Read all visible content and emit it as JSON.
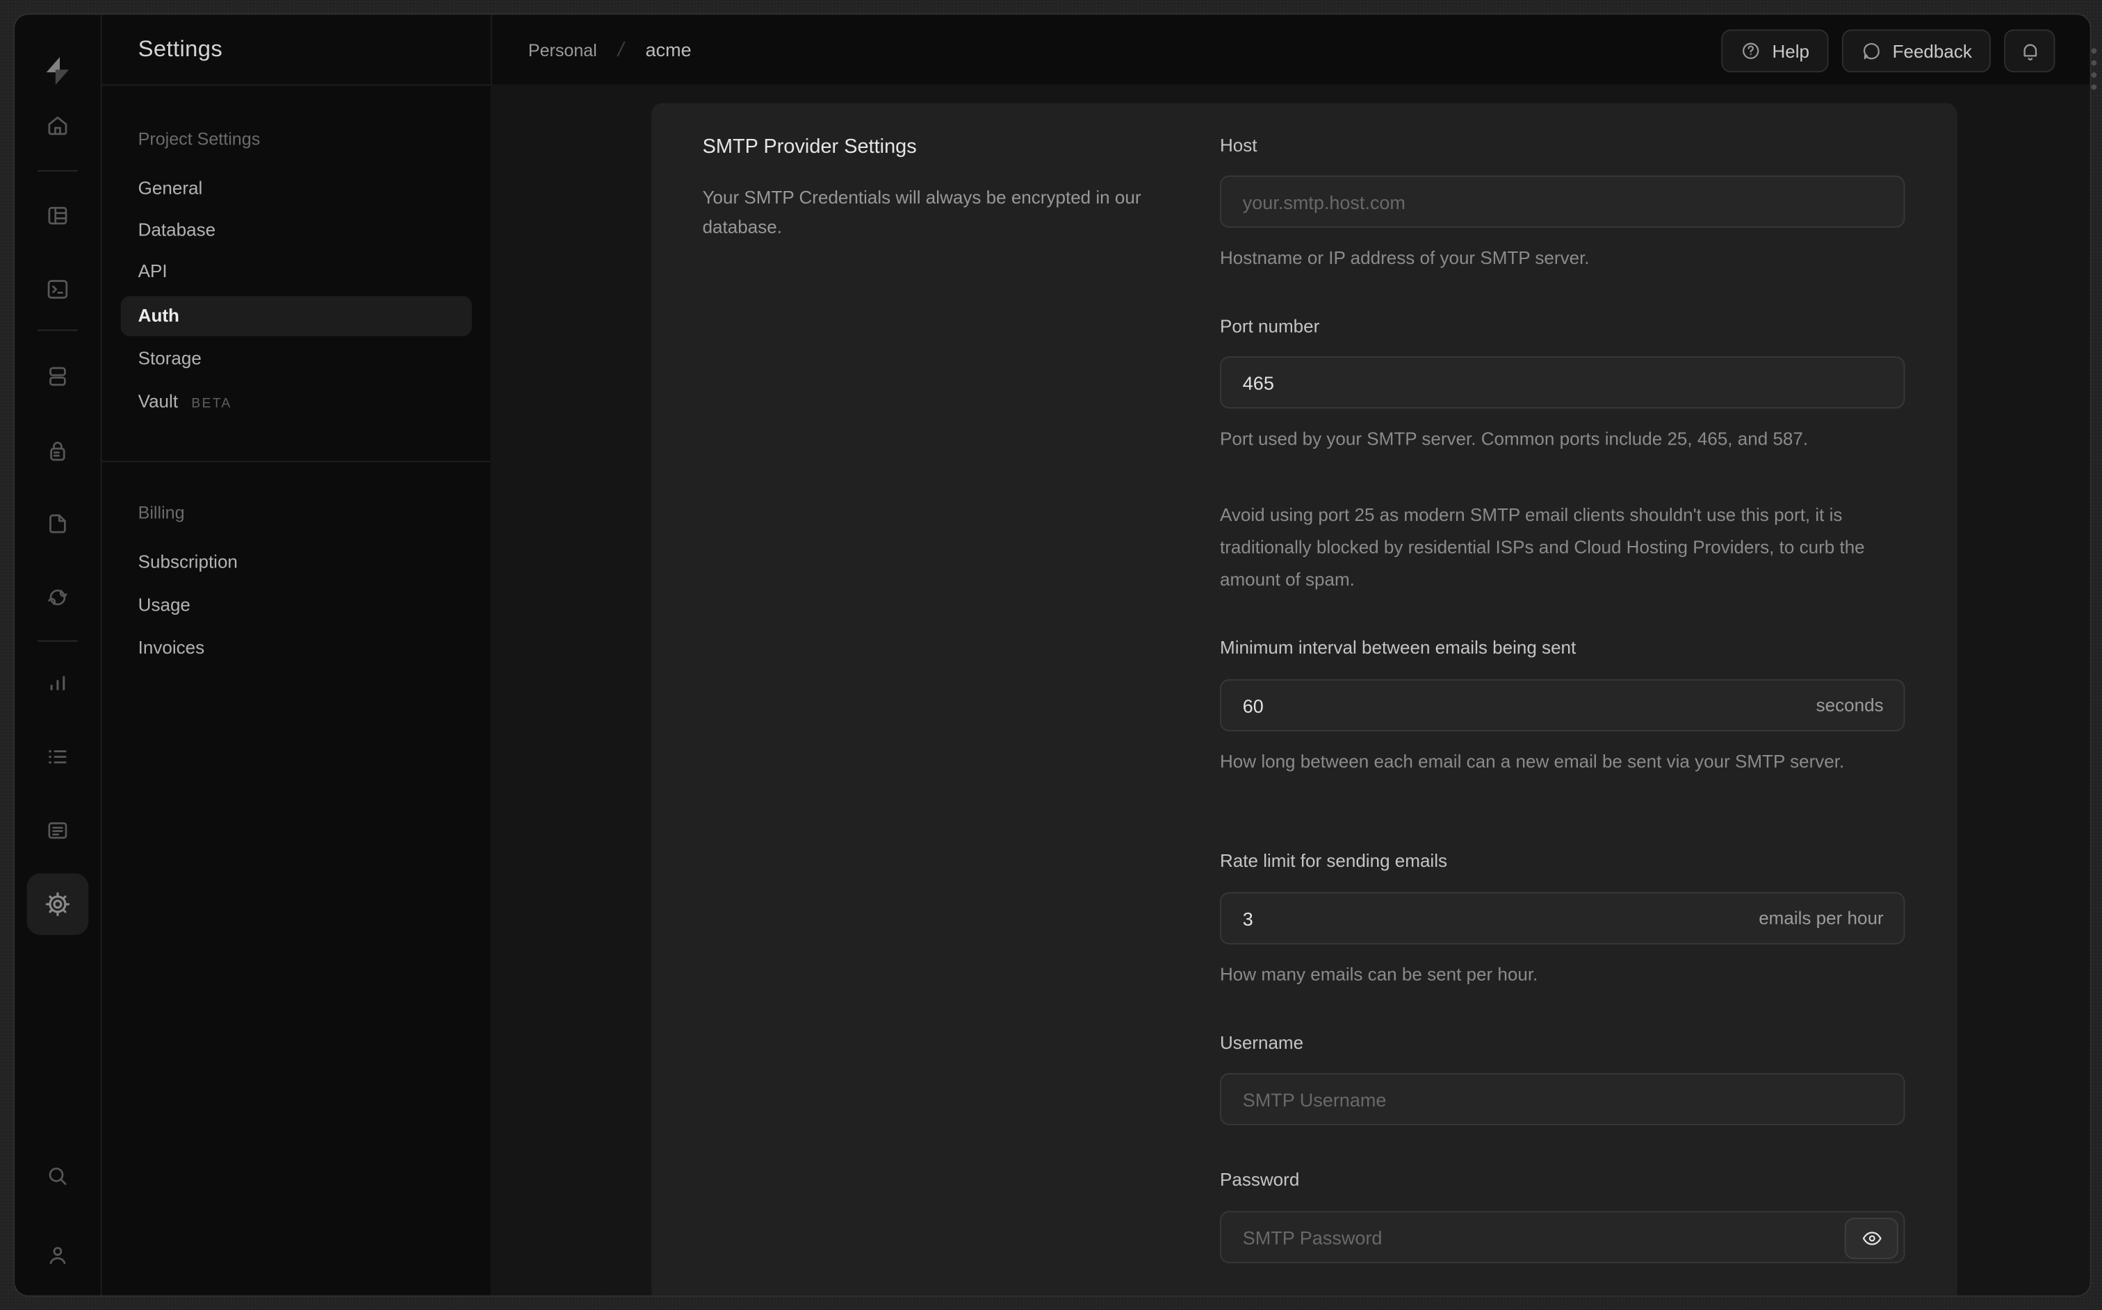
{
  "breadcrumb": {
    "org": "Personal",
    "separator": "/",
    "project": "acme"
  },
  "topbar": {
    "help_label": "Help",
    "feedback_label": "Feedback"
  },
  "sidebar": {
    "title": "Settings",
    "sections": [
      {
        "header": "Project Settings",
        "items": [
          {
            "label": "General"
          },
          {
            "label": "Database"
          },
          {
            "label": "API"
          },
          {
            "label": "Auth",
            "active": true
          },
          {
            "label": "Storage"
          },
          {
            "label": "Vault",
            "badge": "BETA"
          }
        ]
      },
      {
        "header": "Billing",
        "items": [
          {
            "label": "Subscription"
          },
          {
            "label": "Usage"
          },
          {
            "label": "Invoices"
          }
        ]
      }
    ],
    "rail_icons": [
      "supabase-logo",
      "home",
      "table-editor",
      "sql-editor",
      "database",
      "auth",
      "storage",
      "realtime",
      "reports",
      "logs",
      "docs",
      "settings",
      "search",
      "profile"
    ]
  },
  "panel": {
    "title": "SMTP Provider Settings",
    "description": "Your SMTP Credentials will always be encrypted in our database.",
    "fields": {
      "host": {
        "label": "Host",
        "placeholder": "your.smtp.host.com",
        "help": "Hostname or IP address of your SMTP server."
      },
      "port": {
        "label": "Port number",
        "value": "465",
        "help": "Port used by your SMTP server. Common ports include 25, 465, and 587.",
        "note": "Avoid using port 25 as modern SMTP email clients shouldn't use this port, it is traditionally blocked by residential ISPs and Cloud Hosting Providers, to curb the amount of spam."
      },
      "interval": {
        "label": "Minimum interval between emails being sent",
        "value": "60",
        "unit": "seconds",
        "help": "How long between each email can a new email be sent via your SMTP server."
      },
      "rate": {
        "label": "Rate limit for sending emails",
        "value": "3",
        "unit": "emails per hour",
        "help": "How many emails can be sent per hour."
      },
      "username": {
        "label": "Username",
        "placeholder": "SMTP Username"
      },
      "password": {
        "label": "Password",
        "placeholder": "SMTP Password"
      }
    }
  },
  "colors": {
    "frame_bg": "#232323",
    "window_bg": "#0c0c0c",
    "card_bg": "#212121",
    "input_bg": "#262626",
    "input_border": "#383838",
    "text_primary": "#e6e6e6",
    "text_muted": "#8b8b8b",
    "nav_active_bg": "#1d1d1d"
  }
}
